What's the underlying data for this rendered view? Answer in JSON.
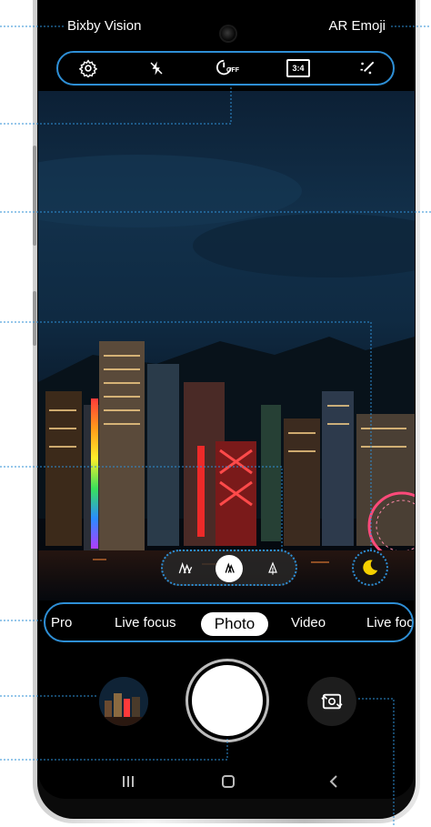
{
  "top": {
    "bixby_label": "Bixby Vision",
    "ar_emoji_label": "AR Emoji"
  },
  "quick_settings": [
    {
      "name": "settings-icon"
    },
    {
      "name": "flash-off-icon"
    },
    {
      "name": "timer-off-icon",
      "text": "OFF"
    },
    {
      "name": "aspect-ratio-icon",
      "text": "3:4"
    },
    {
      "name": "filters-icon"
    }
  ],
  "scene_options": [
    "wide-angle-icon",
    "normal-angle-icon",
    "tele-angle-icon"
  ],
  "modes": {
    "items": [
      "Pro",
      "Live focus",
      "Photo",
      "Video",
      "Live focu"
    ],
    "active": "Photo"
  },
  "colors": {
    "accent": "#2e8fd6",
    "night_moon": "#f5d000"
  },
  "icons": {
    "gallery": "gallery-thumbnail",
    "shutter": "shutter-button",
    "switch": "switch-camera-icon",
    "nav": [
      "recents-icon",
      "home-icon",
      "back-icon"
    ]
  }
}
